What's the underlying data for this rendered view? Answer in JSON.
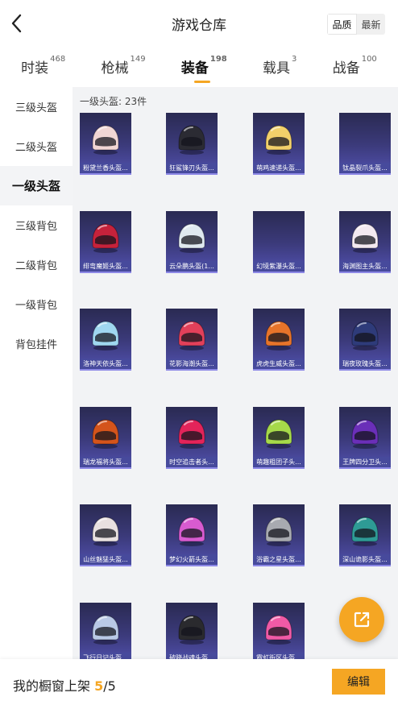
{
  "header": {
    "title": "游戏仓库",
    "sort_options": [
      "品质",
      "最新"
    ],
    "active_sort": "品质"
  },
  "tabs": [
    {
      "label": "时装",
      "count": "468"
    },
    {
      "label": "枪械",
      "count": "149"
    },
    {
      "label": "装备",
      "count": "198",
      "active": true
    },
    {
      "label": "载具",
      "count": "3"
    },
    {
      "label": "战备",
      "count": "100"
    }
  ],
  "sidebar": {
    "items": [
      "三级头盔",
      "二级头盔",
      "一级头盔",
      "三级背包",
      "二级背包",
      "一级背包",
      "背包挂件"
    ],
    "active_index": 2
  },
  "content": {
    "count_label": "一级头盔: 23件",
    "items": [
      {
        "name": "粉黛兰香头盔...",
        "color": "#f1d6d4"
      },
      {
        "name": "狂鲨锋刃头盔...",
        "color": "#2b2b33"
      },
      {
        "name": "萌鸡速递头盔...",
        "color": "#f2d06a"
      },
      {
        "name": "钛晶裂爪头盔...",
        "color": ""
      },
      {
        "name": "绯弯魔姬头盔...",
        "color": "#c6223b"
      },
      {
        "name": "云朵鹏头盔(1...",
        "color": "#dfe9ef"
      },
      {
        "name": "幻境紫瀑头盔...",
        "color": ""
      },
      {
        "name": "海渊图主头盔...",
        "color": "#f3e9f0"
      },
      {
        "name": "洛神天依头盔...",
        "color": "#9fd7f0"
      },
      {
        "name": "花影海潮头盔...",
        "color": "#e2405a"
      },
      {
        "name": "虎虎生威头盔...",
        "color": "#e7742a"
      },
      {
        "name": "瑞夜玫瑰头盔...",
        "color": "#2e3b7a"
      },
      {
        "name": "瑞龙福将头盔...",
        "color": "#d4541b"
      },
      {
        "name": "时空追击者头...",
        "color": "#e3245a"
      },
      {
        "name": "萌趣粗团子头...",
        "color": "#a6d94a"
      },
      {
        "name": "王牌四分卫头...",
        "color": "#6a2fb8"
      },
      {
        "name": "山丝魅猛头盔...",
        "color": "#e8e0e0"
      },
      {
        "name": "梦幻火箭头盔...",
        "color": "#d85bd0"
      },
      {
        "name": "浴霸之星头盔...",
        "color": "#a8aab0"
      },
      {
        "name": "深山诡影头盔...",
        "color": "#2e9b95"
      },
      {
        "name": "飞行日记头盔...",
        "color": "#b9c9e6"
      },
      {
        "name": "破晓战魂头盔...",
        "color": "#2a2a2e"
      },
      {
        "name": "霓虹街区头盔...",
        "color": "#f05aa6"
      }
    ]
  },
  "bottom": {
    "shelf_label": "我的橱窗上架",
    "shelf_count": "5",
    "shelf_total": "/5",
    "edit_label": "编辑"
  },
  "colors": {
    "accent": "#f5a623",
    "card_bg": "#3b3a7a",
    "name_bar": "#474a9c"
  }
}
